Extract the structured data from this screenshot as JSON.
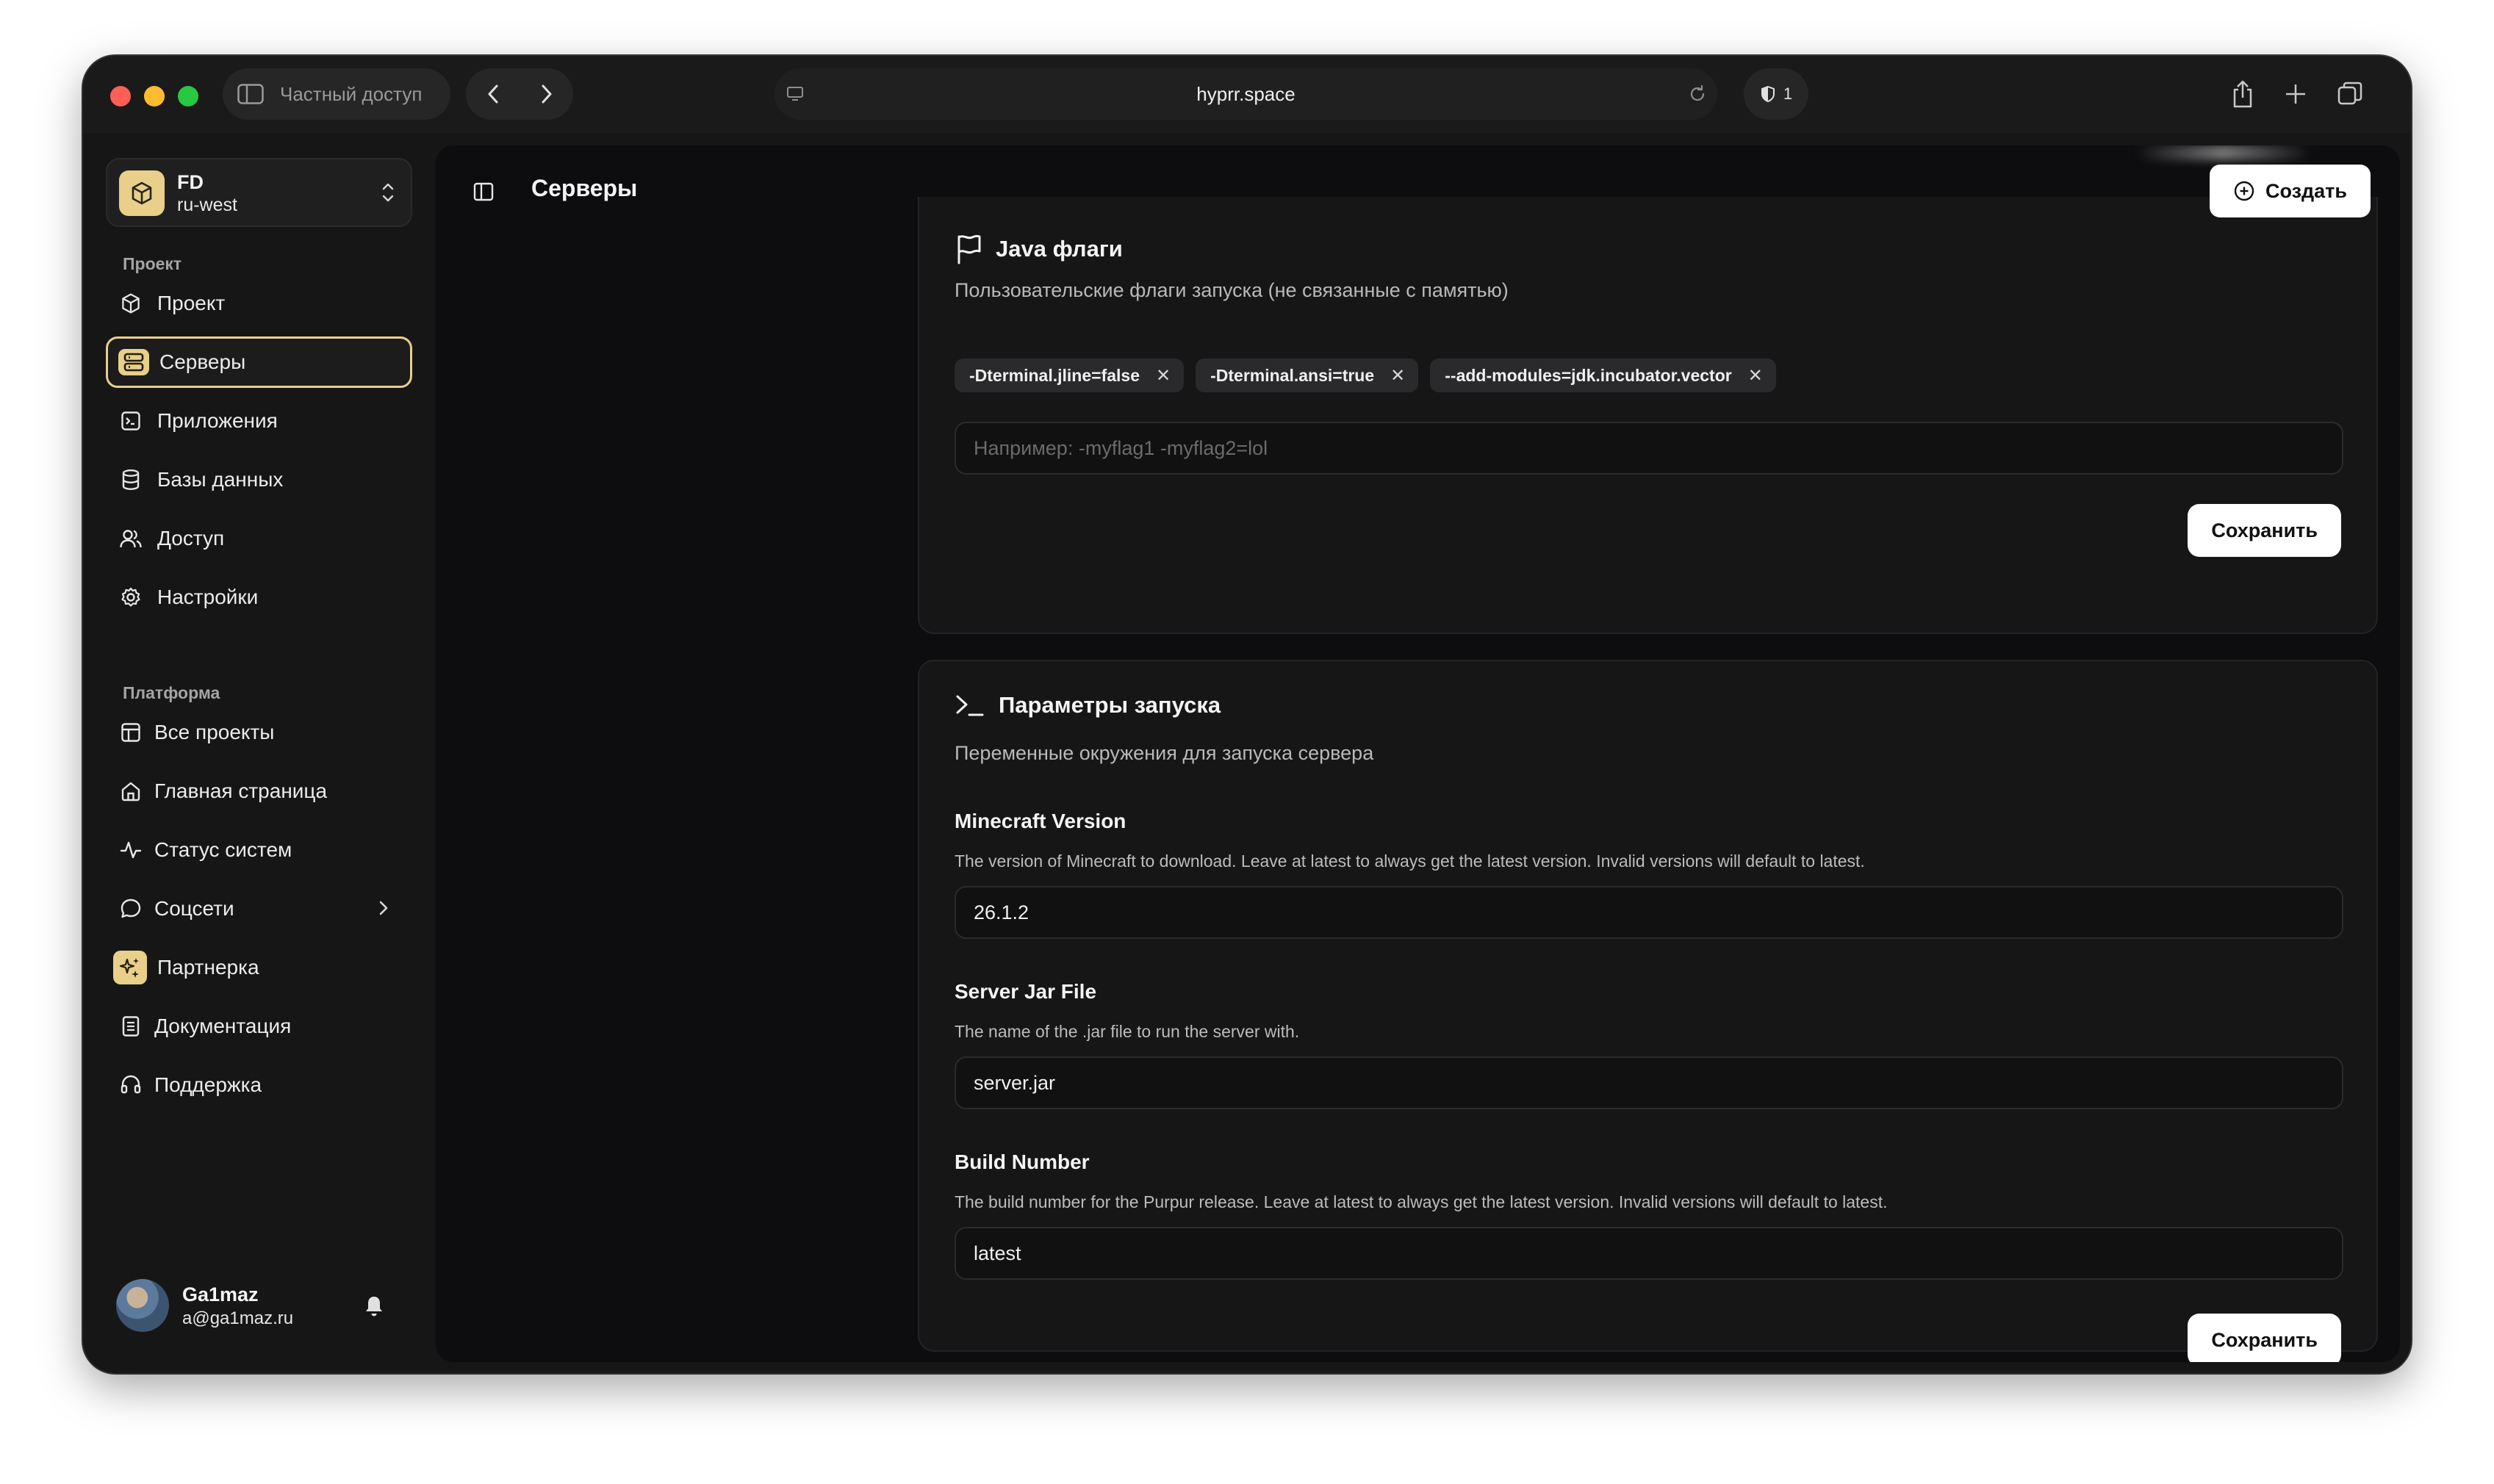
{
  "browser": {
    "private_label": "Частный доступ",
    "url": "hyprr.space",
    "shield_count": "1"
  },
  "sidebar": {
    "workspace": {
      "name": "FD",
      "region": "ru-west"
    },
    "section_project": "Проект",
    "project_items": [
      {
        "label": "Проект",
        "icon": "cube-icon"
      },
      {
        "label": "Серверы",
        "icon": "server-icon",
        "active": true
      },
      {
        "label": "Приложения",
        "icon": "terminal-window-icon"
      },
      {
        "label": "Базы данных",
        "icon": "database-icon"
      },
      {
        "label": "Доступ",
        "icon": "users-icon"
      },
      {
        "label": "Настройки",
        "icon": "gear-icon"
      }
    ],
    "section_platform": "Платформа",
    "platform_items": [
      {
        "label": "Все проекты",
        "icon": "layout-icon"
      },
      {
        "label": "Главная страница",
        "icon": "home-icon"
      },
      {
        "label": "Статус систем",
        "icon": "activity-icon"
      },
      {
        "label": "Соцсети",
        "icon": "chat-bubble-icon"
      },
      {
        "label": "Партнерка",
        "icon": "sparkles-icon"
      },
      {
        "label": "Документация",
        "icon": "document-icon"
      },
      {
        "label": "Поддержка",
        "icon": "headset-icon"
      }
    ],
    "user": {
      "name": "Ga1maz",
      "email": "a@ga1maz.ru"
    }
  },
  "main": {
    "title": "Серверы",
    "create_label": "Создать",
    "java_flags": {
      "title": "Java флаги",
      "description": "Пользовательские флаги запуска (не связанные с памятью)",
      "chips": [
        "-Dterminal.jline=false",
        "-Dterminal.ansi=true",
        "--add-modules=jdk.incubator.vector"
      ],
      "input_placeholder": "Например: -myflag1 -myflag2=lol",
      "save_label": "Сохранить"
    },
    "launch_params": {
      "title": "Параметры запуска",
      "description": "Переменные окружения для запуска сервера",
      "fields": [
        {
          "label": "Minecraft Version",
          "help": "The version of Minecraft to download.   Leave at latest to always get the latest version. Invalid versions will default to latest.",
          "value": "26.1.2"
        },
        {
          "label": "Server Jar File",
          "help": "The name of the .jar file to run the server with.",
          "value": "server.jar"
        },
        {
          "label": "Build Number",
          "help": "The build number for the Purpur release.  Leave at latest to always get the latest version. Invalid versions will default to latest.",
          "value": "latest"
        }
      ],
      "save_label": "Сохранить"
    }
  },
  "colors": {
    "accent": "#e8cf8a",
    "background": "#0d0d0f",
    "card": "#161617"
  }
}
